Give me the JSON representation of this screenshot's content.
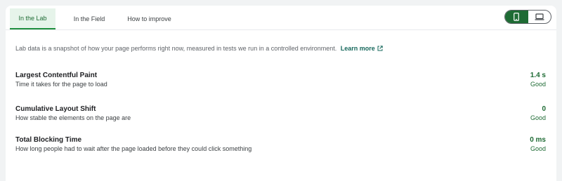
{
  "tabs": [
    {
      "label": "In the Lab",
      "active": true
    },
    {
      "label": "In the Field",
      "active": false
    },
    {
      "label": "How to improve",
      "active": false
    }
  ],
  "device_toggle": {
    "mobile": {
      "icon": "mobile-phone-icon",
      "active": true
    },
    "desktop": {
      "icon": "laptop-icon",
      "active": false
    }
  },
  "description": {
    "text": "Lab data is a snapshot of how your page performs right now, measured in tests we run in a controlled environment.",
    "link_label": "Learn more",
    "link_icon": "external-link-icon"
  },
  "metrics": [
    {
      "name": "Largest Contentful Paint",
      "description": "Time it takes for the page to load",
      "value": "1.4 s",
      "rating": "Good"
    },
    {
      "name": "Cumulative Layout Shift",
      "description": "How stable the elements on the page are",
      "value": "0",
      "rating": "Good"
    },
    {
      "name": "Total Blocking Time",
      "description": "How long people had to wait after the page loaded before they could click something",
      "value": "0 ms",
      "rating": "Good"
    }
  ],
  "colors": {
    "accent": "#1e6b34",
    "active_tab_bg": "#e6f4ea",
    "link": "#17685c"
  }
}
